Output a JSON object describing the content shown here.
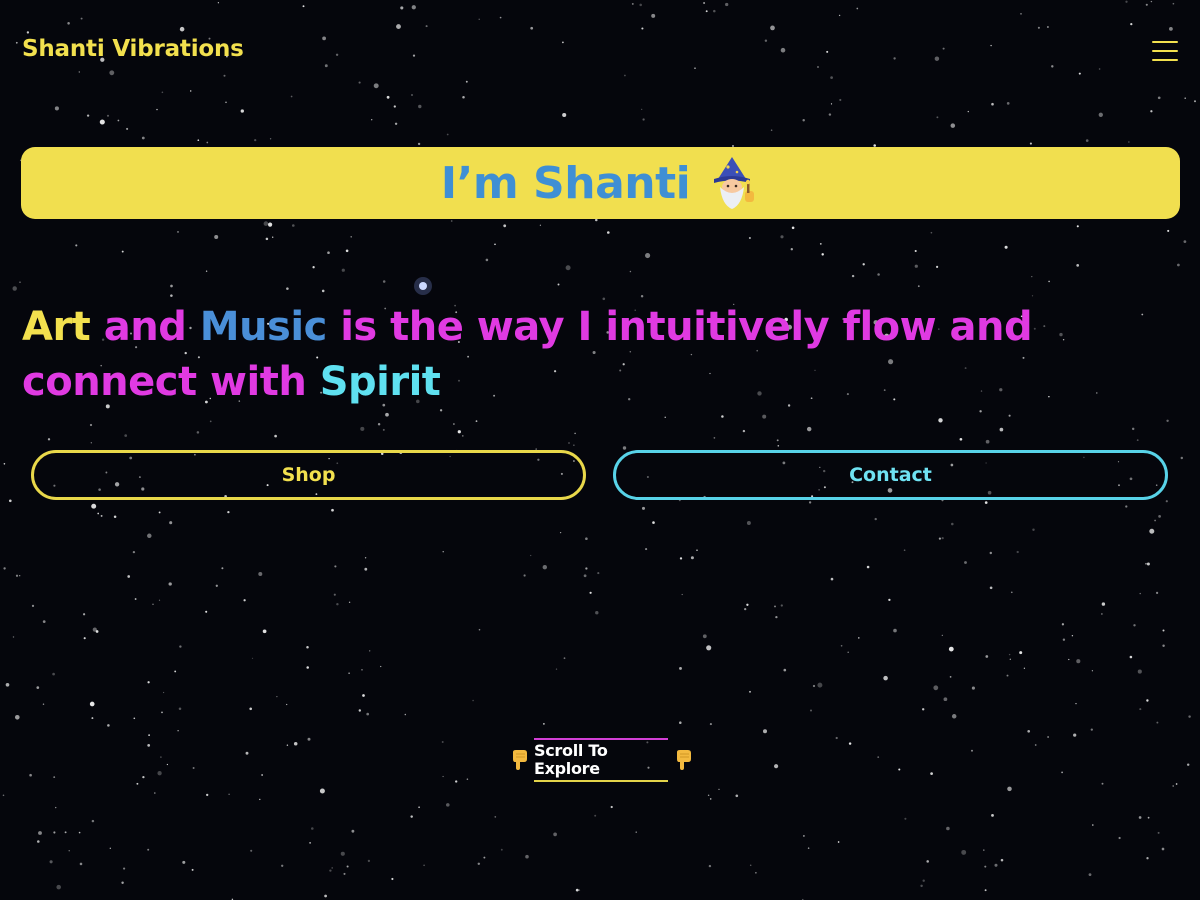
{
  "header": {
    "brand": "Shanti Vibrations",
    "menu_icon": "hamburger-menu-icon"
  },
  "banner": {
    "title": "I’m Shanti",
    "emoji_icon": "wizard-emoji-icon"
  },
  "tagline": {
    "segments": [
      {
        "text": "Art",
        "color": "#f2e04e"
      },
      {
        "text": " and ",
        "color": "#e03ae2"
      },
      {
        "text": "Music",
        "color": "#4a8fd8"
      },
      {
        "text": " is the way I intuitively flow and connect with ",
        "color": "#e03ae2"
      },
      {
        "text": "Spirit",
        "color": "#5fe0f0"
      }
    ]
  },
  "buttons": {
    "shop": "Shop",
    "contact": "Contact"
  },
  "scroll": {
    "label": "Scroll To Explore",
    "icon": "pointing-down-hand-icon"
  },
  "colors": {
    "background": "#05060c",
    "accent_yellow": "#f2e04e",
    "accent_magenta": "#e03ae2",
    "accent_blue": "#4a8fd8",
    "accent_cyan": "#5fe0f0"
  }
}
